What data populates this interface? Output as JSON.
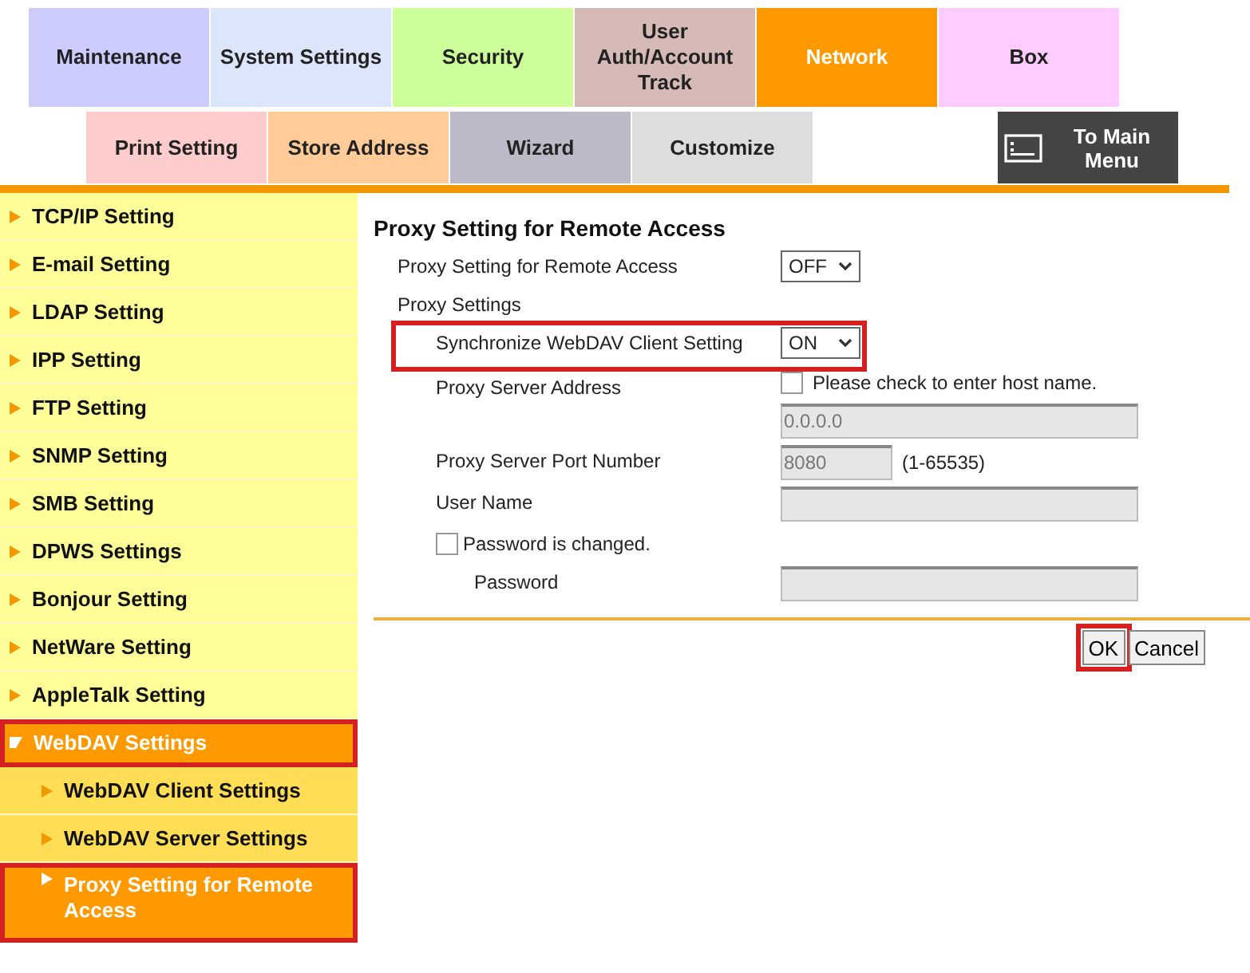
{
  "top_tabs": [
    {
      "label": "Maintenance",
      "color": "#ccccff",
      "selected": false
    },
    {
      "label": "System Settings",
      "color": "#dce6fb",
      "selected": false
    },
    {
      "label": "Security",
      "color": "#ccff99",
      "selected": false
    },
    {
      "label": "User Auth/Account Track",
      "color": "#d5bab6",
      "selected": false
    },
    {
      "label": "Network",
      "color": "#ff9900",
      "selected": true
    },
    {
      "label": "Box",
      "color": "#ffccff",
      "selected": false
    }
  ],
  "sub_tabs": [
    {
      "label": "Print Setting",
      "color": "#ffcccc"
    },
    {
      "label": "Store Address",
      "color": "#ffcc99"
    },
    {
      "label": "Wizard",
      "color": "#bcbac8"
    },
    {
      "label": "Customize",
      "color": "#dddddd"
    }
  ],
  "main_menu_button": {
    "label": "To Main Menu"
  },
  "sidebar": {
    "items": [
      {
        "label": "TCP/IP Setting",
        "selected": false,
        "highlighted": false
      },
      {
        "label": "E-mail Setting",
        "selected": false,
        "highlighted": false
      },
      {
        "label": "LDAP Setting",
        "selected": false,
        "highlighted": false
      },
      {
        "label": "IPP Setting",
        "selected": false,
        "highlighted": false
      },
      {
        "label": "FTP Setting",
        "selected": false,
        "highlighted": false
      },
      {
        "label": "SNMP Setting",
        "selected": false,
        "highlighted": false
      },
      {
        "label": "SMB Setting",
        "selected": false,
        "highlighted": false
      },
      {
        "label": "DPWS Settings",
        "selected": false,
        "highlighted": false
      },
      {
        "label": "Bonjour Setting",
        "selected": false,
        "highlighted": false
      },
      {
        "label": "NetWare Setting",
        "selected": false,
        "highlighted": false
      },
      {
        "label": "AppleTalk Setting",
        "selected": false,
        "highlighted": false
      },
      {
        "label": "WebDAV Settings",
        "selected": true,
        "highlighted": true,
        "expanded": true,
        "children": [
          {
            "label": "WebDAV Client Settings",
            "selected": false,
            "highlighted": false
          },
          {
            "label": "WebDAV Server Settings",
            "selected": false,
            "highlighted": false
          },
          {
            "label": "Proxy Setting for Remote Access",
            "selected": true,
            "highlighted": true
          }
        ]
      }
    ]
  },
  "form": {
    "title": "Proxy Setting for Remote Access",
    "fields": [
      {
        "kind": "select",
        "label": "Proxy Setting for Remote Access",
        "value": "OFF",
        "highlighted": false
      },
      {
        "kind": "group",
        "label": "Proxy Settings",
        "children": [
          {
            "kind": "select",
            "label": "Synchronize WebDAV Client Setting",
            "value": "ON",
            "highlighted": true
          },
          {
            "kind": "address",
            "label": "Proxy Server Address",
            "option": {
              "label": "Please check to enter host name.",
              "checked": false
            },
            "value": "0.0.0.0",
            "disabled": true
          },
          {
            "kind": "port",
            "label": "Proxy Server Port Number",
            "value": "8080",
            "hint": "(1-65535)",
            "disabled": true
          },
          {
            "kind": "text",
            "label": "User Name",
            "disabled": true
          },
          {
            "kind": "checkbox",
            "label": "Password is changed.",
            "checked": false,
            "children": [
              {
                "kind": "text",
                "label": "Password",
                "disabled": true
              }
            ]
          }
        ]
      }
    ],
    "buttons": [
      {
        "label": "OK",
        "highlighted": true
      },
      {
        "label": "Cancel",
        "highlighted": false
      }
    ]
  }
}
